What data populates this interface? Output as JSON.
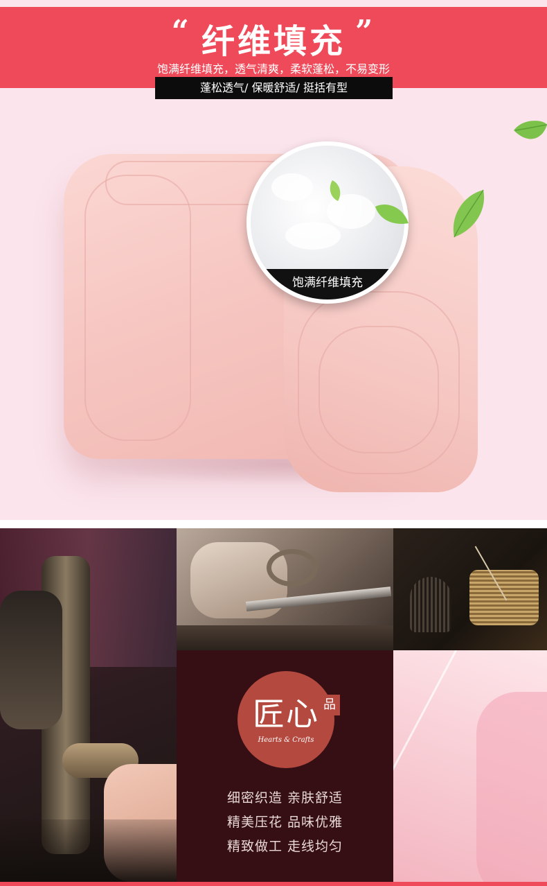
{
  "header": {
    "quote_open": "“",
    "title": "纤维填充",
    "quote_close": "”",
    "subtitle": "饱满纤维填充，透气清爽，柔软蓬松，不易变形",
    "tagline": "蓬松透气/ 保暖舒适/ 挺括有型"
  },
  "product": {
    "zoom_label": "饱满纤维填充"
  },
  "brand": {
    "logo_text": "匠心",
    "logo_badge": "品",
    "logo_sub": "Hearts & Crafts",
    "features": [
      "细密织造  亲肤舒适",
      "精美压花  品味优雅",
      "精致做工  走线均匀"
    ]
  },
  "colors": {
    "accent": "#ef4a59",
    "background": "#fbe4ec",
    "brand_panel": "#360f14",
    "logo": "#b4493f"
  }
}
